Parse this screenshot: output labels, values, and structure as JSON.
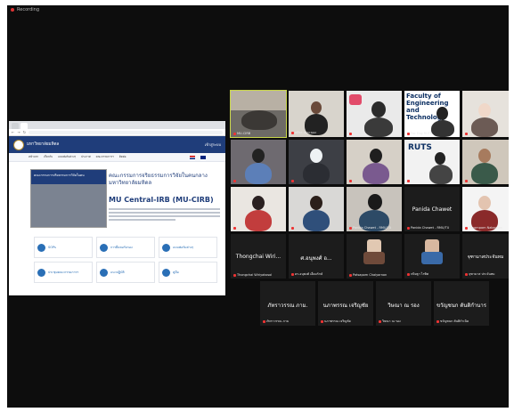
{
  "recording_label": "Recording",
  "share": {
    "tabs": [
      "",
      ""
    ],
    "url": "",
    "university_name": "มหาวิทยาลัยมหิดล",
    "university_sub": "",
    "login": "เข้าสู่ระบบ",
    "nav": [
      "หน้าแรก",
      "เกี่ยวกับ",
      "แบบฟอร์มต่างๆ",
      "ประกาศ",
      "คณะกรรมการฯ",
      "ติดต่อ"
    ],
    "banner": "คณะกรรมการจริยธรรมการวิจัยในคน",
    "title": "คณะกรรมการจริยธรรมการวิจัยในคนกลาง มหาวิทยาลัยมหิดล",
    "subtitle": "MU Central-IRB (MU-CIRB)",
    "cards": [
      "SOPs",
      "การยื่นขอรับรอง",
      "แบบฟอร์มต่างๆ",
      "ประชุมคณะกรรมการฯ",
      "แนวปฏิบัติ",
      "คู่มือ"
    ]
  },
  "participants": [
    {
      "name": "MU-CIRB",
      "label": ""
    },
    {
      "name": "ศศิธร ณ ระนอง",
      "label": ""
    },
    {
      "name": "Paveena",
      "label": ""
    },
    {
      "name": "Fac Eng RUTS",
      "label": ""
    },
    {
      "name": "",
      "label": ""
    },
    {
      "name": "",
      "label": ""
    },
    {
      "name": "",
      "label": ""
    },
    {
      "name": "",
      "label": ""
    },
    {
      "name": "",
      "label": ""
    },
    {
      "name": "",
      "label": ""
    },
    {
      "name": "",
      "label": ""
    },
    {
      "name": "",
      "label": ""
    },
    {
      "name": "Panida Chawet - RMU/TU",
      "label": "Panida Chawet"
    },
    {
      "name": "Payompom Nakachon",
      "label": ""
    },
    {
      "name": "Thongchai Wiriyakosol",
      "label": "Thongchai Wiri..."
    },
    {
      "name": "ดร.อนุพงศ์ เอี่ยมรักษ์",
      "label": "ศ.อนุพงศ์ อ..."
    },
    {
      "name": "Patsapom Chaiyarnon",
      "label": ""
    },
    {
      "name": "กนิษฐา ไรทิศ",
      "label": ""
    },
    {
      "name": "จุฑามาส ประจันทม",
      "label": "จุฑามาสประจันทม"
    },
    {
      "name": "ภัทราวรรณ ภาม",
      "label": "ภัทราวรรณ ภาม."
    },
    {
      "name": "นภาพรรณ เจริญชัย",
      "label": "นภาพรรณ เจริญชัย"
    },
    {
      "name": "วิษณา ณ รอง",
      "label": "วิษณา ณ รอง"
    },
    {
      "name": "ขวัญชนก ตันติกำเนิด",
      "label": "ขวัญชนก ตันติกำนาร"
    }
  ]
}
